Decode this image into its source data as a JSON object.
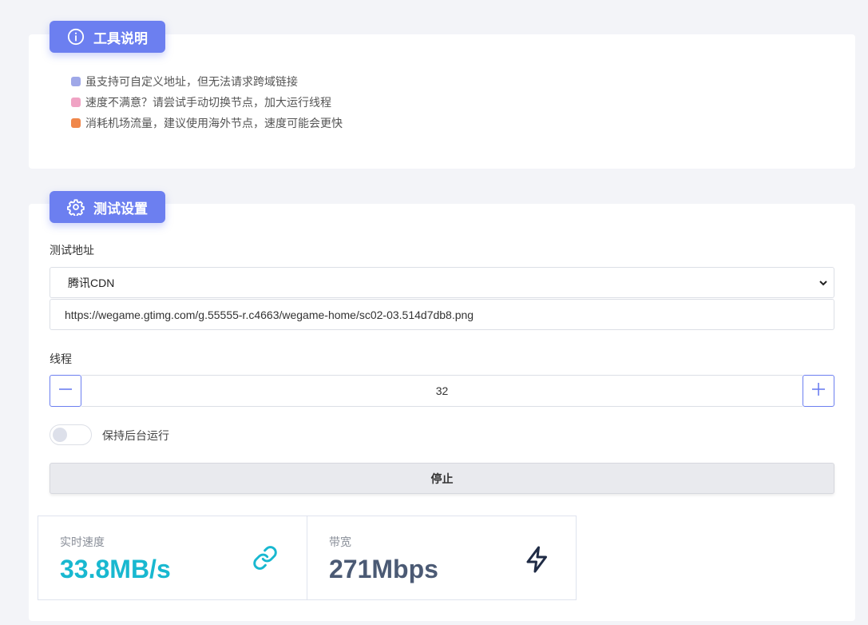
{
  "info_section": {
    "title": "工具说明",
    "icon": "info-circle-icon",
    "tips": [
      {
        "text": "虽支持可自定义地址，但无法请求跨域链接",
        "color": "#9fa8e8"
      },
      {
        "text": "速度不满意？请尝试手动切换节点，加大运行线程",
        "color": "#f0a3c4"
      },
      {
        "text": "消耗机场流量，建议使用海外节点，速度可能会更快",
        "color": "#f0874a"
      }
    ]
  },
  "settings_section": {
    "title": "测试设置",
    "icon": "gear-icon",
    "address_label": "测试地址",
    "address_select": "腾讯CDN",
    "address_url": "https://wegame.gtimg.com/g.55555-r.c4663/wegame-home/sc02-03.514d7db8.png",
    "threads_label": "线程",
    "threads_value": "32",
    "background_toggle_label": "保持后台运行",
    "background_toggle_on": false,
    "stop_button": "停止"
  },
  "stats": {
    "speed_label": "实时速度",
    "speed_value": "33.8MB/s",
    "speed_icon": "link-icon",
    "bandwidth_label": "带宽",
    "bandwidth_value": "271Mbps",
    "bandwidth_icon": "lightning-icon"
  },
  "colors": {
    "accent": "#6c7ff0",
    "speed": "#18b8d0",
    "bandwidth": "#4b5a74"
  }
}
